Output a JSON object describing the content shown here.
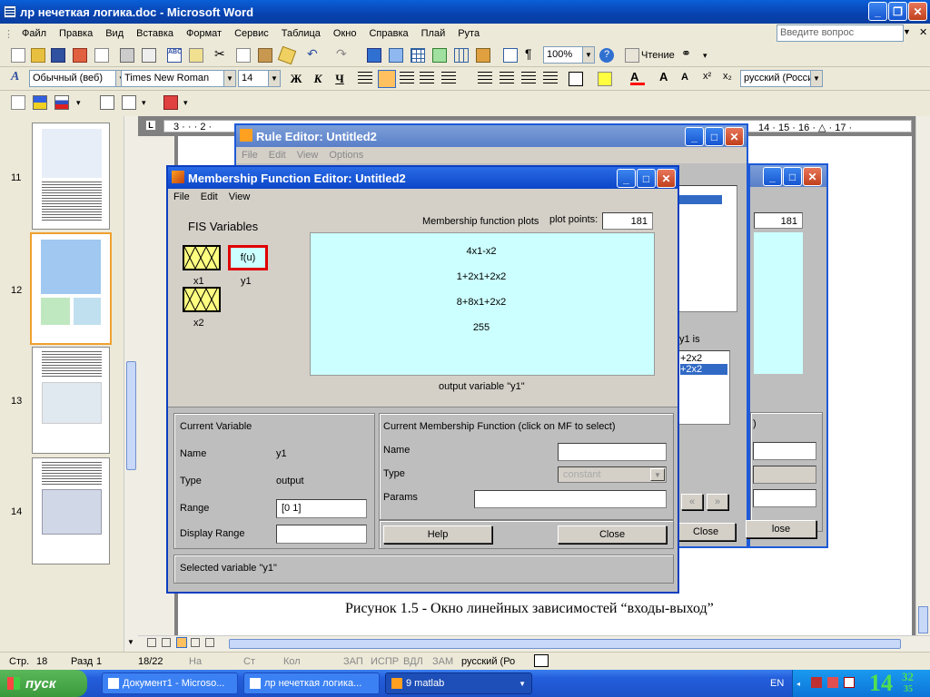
{
  "word": {
    "title": "лр нечеткая логика.doc - Microsoft Word",
    "menu": [
      "Файл",
      "Правка",
      "Вид",
      "Вставка",
      "Формат",
      "Сервис",
      "Таблица",
      "Окно",
      "Справка",
      "Плай",
      "Рута"
    ],
    "ask_placeholder": "Введите вопрос",
    "zoom": "100%",
    "reading_label": "Чтение",
    "style": "Обычный (веб)",
    "font": "Times New Roman",
    "size": "14",
    "bold": "Ж",
    "italic": "К",
    "underline": "Ч",
    "lang_combo": "русский (Росси",
    "ruler_nums": "14 · 15 · 16 · △ · 17 ·",
    "ruler_left": "3 · · · 2 ·",
    "thumbs": [
      "11",
      "12",
      "13",
      "14"
    ],
    "caption": "Рисунок 1.5 - Окно линейных зависимостей “входы-выход”",
    "status": {
      "page": "Стр.",
      "page_num": "18",
      "section": "Разд",
      "section_num": "1",
      "pages": "18/22",
      "at": "На",
      "line": "Ст",
      "col": "Кол",
      "rec": "ЗАП",
      "trk": "ИСПР",
      "ext": "ВДЛ",
      "ovr": "ЗАМ",
      "lang": "русский (Ро"
    }
  },
  "rule_editor": {
    "title": "Rule Editor: Untitled2",
    "menu": [
      "File",
      "Edit",
      "View",
      "Options"
    ],
    "then_label": "y1 is",
    "list_items": [
      "+2x2",
      "+2x2"
    ],
    "close": "Close",
    "frag_close2": "lose",
    "frag_paren": ")"
  },
  "back_mf": {
    "plot_points": "181",
    "close": "Close"
  },
  "mf_editor": {
    "title": "Membership Function Editor: Untitled2",
    "menu": [
      "File",
      "Edit",
      "View"
    ],
    "fis_variables": "FIS Variables",
    "x1": "x1",
    "x2": "x2",
    "y1": "y1",
    "fu": "f(u)",
    "plot_header": "Membership function plots",
    "plot_points_label": "plot points:",
    "plot_points": "181",
    "mfs": [
      "4x1-x2",
      "1+2x1+2x2",
      "8+8x1+2x2",
      "255"
    ],
    "output_var": "output variable \"y1\"",
    "current_variable": {
      "header": "Current Variable",
      "name_label": "Name",
      "name_value": "y1",
      "type_label": "Type",
      "type_value": "output",
      "range_label": "Range",
      "range_value": "[0 1]",
      "display_range_label": "Display Range",
      "display_range_value": ""
    },
    "current_mf": {
      "header": "Current Membership Function (click on MF to select)",
      "name_label": "Name",
      "type_label": "Type",
      "type_value": "constant",
      "params_label": "Params"
    },
    "help": "Help",
    "close": "Close",
    "status": "Selected variable \"y1\""
  },
  "taskbar": {
    "start": "пуск",
    "items": [
      "Документ1 - Microso...",
      "лр нечеткая логика...",
      "9 matlab"
    ],
    "lang": "EN",
    "clock_h": "14",
    "clock_m": "32",
    "clock_s": "35"
  }
}
